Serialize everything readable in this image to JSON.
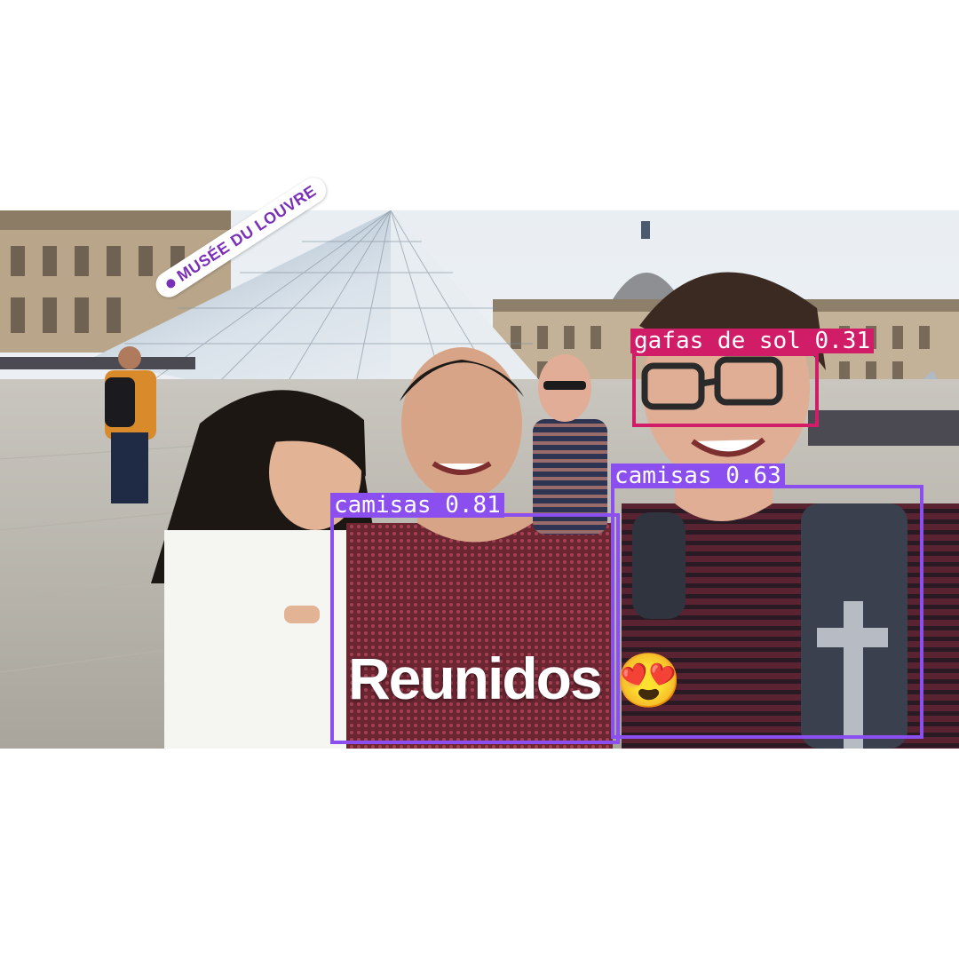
{
  "location_sticker": {
    "text": "MUSÉE DU LOUVRE",
    "icon": "location-pin-icon"
  },
  "caption": {
    "text": "Reunidos",
    "emoji": "😍"
  },
  "detections": [
    {
      "label": "gafas de sol 0.31",
      "color": "#d11d68"
    },
    {
      "label": "camisas 0.81",
      "color": "#8b4ff0"
    },
    {
      "label": "camisas 0.63",
      "color": "#8b4ff0"
    }
  ]
}
